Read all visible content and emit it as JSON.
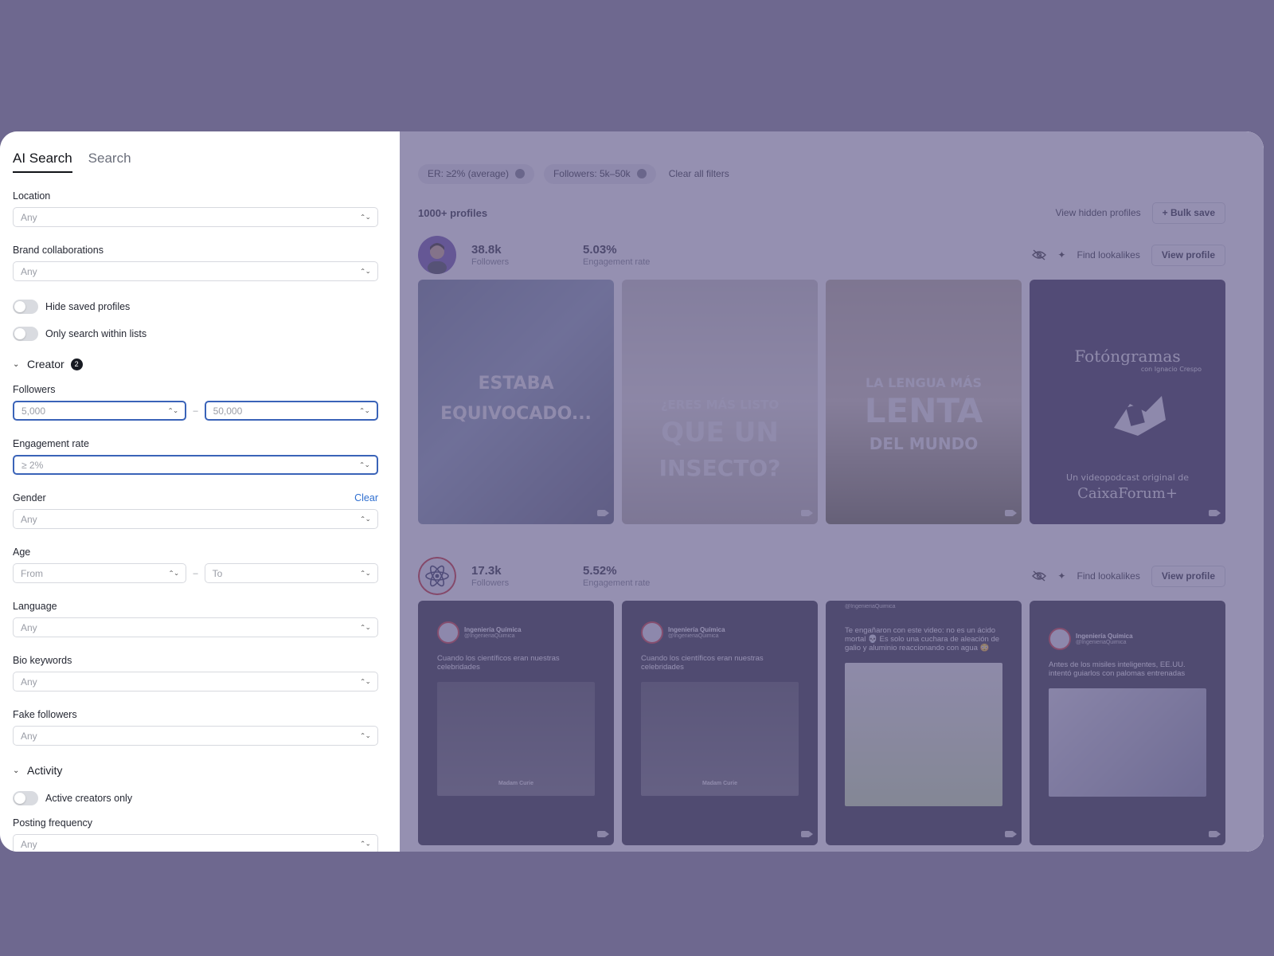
{
  "sidebar": {
    "tabs": [
      {
        "label": "AI Search"
      },
      {
        "label": "Search"
      }
    ],
    "location": {
      "label": "Location",
      "value": "Any"
    },
    "brand_collaborations": {
      "label": "Brand collaborations",
      "value": "Any"
    },
    "toggles": {
      "hide_saved": "Hide saved profiles",
      "only_lists": "Only search within lists"
    },
    "creator_section": {
      "title": "Creator",
      "badge": "2"
    },
    "followers": {
      "label": "Followers",
      "from_placeholder": "5,000",
      "dash": "–",
      "to_placeholder": "50,000"
    },
    "engagement": {
      "label": "Engagement rate",
      "placeholder": "≥ 2%"
    },
    "gender": {
      "label": "Gender",
      "clear": "Clear",
      "value": "Any"
    },
    "age": {
      "label": "Age",
      "from": "From",
      "dash": "–",
      "to": "To"
    },
    "language": {
      "label": "Language",
      "value": "Any"
    },
    "bio_keywords": {
      "label": "Bio keywords",
      "value": "Any"
    },
    "fake_followers": {
      "label": "Fake followers",
      "value": "Any"
    },
    "activity_section": {
      "title": "Activity"
    },
    "active_only": "Active creators only",
    "posting_frequency": {
      "label": "Posting frequency",
      "value": "Any"
    }
  },
  "main": {
    "chips": [
      {
        "label": "ER: ≥2% (average)"
      },
      {
        "label": "Followers: 5k–50k"
      }
    ],
    "clear_all": "Clear all filters",
    "count": "1000+ profiles",
    "view_hidden": "View hidden profiles",
    "bulk_save": "+ Bulk save",
    "find_lookalikes": "Find lookalikes",
    "view_profile": "View profile",
    "creators": [
      {
        "followers": "38.8k",
        "followers_label": "Followers",
        "er": "5.03%",
        "er_label": "Engagement rate",
        "tiles": [
          {
            "lines": [
              "ESTABA",
              "EQUIVOCADO..."
            ]
          },
          {
            "lines": [
              "¿ERES MÁS LISTO",
              "QUE UN",
              "INSECTO?"
            ]
          },
          {
            "lines": [
              "LA LENGUA MÁS",
              "LENTA",
              "DEL MUNDO"
            ]
          },
          {
            "lines": [
              "Fotóngramas",
              "con Ignacio Crespo",
              "Un videopodcast original de",
              "CaixaForum+"
            ]
          }
        ]
      },
      {
        "followers": "17.3k",
        "followers_label": "Followers",
        "er": "5.52%",
        "er_label": "Engagement rate",
        "posts": [
          {
            "name": "Ingeniería Química",
            "handle": "@IngenieriaQuimica",
            "text": "Cuando los científicos eran nuestras celebridades",
            "caption": "Madam Curie"
          },
          {
            "name": "Ingeniería Química",
            "handle": "@IngenieriaQuimica",
            "text": "Cuando los científicos eran nuestras celebridades",
            "caption": "Madam Curie"
          },
          {
            "name": "",
            "handle": "@IngenieriaQuimica",
            "text": "Te engañaron con este video: no es un ácido mortal 💀 Es solo una cuchara de aleación de galio y aluminio reaccionando con agua 😳",
            "caption": ""
          },
          {
            "name": "Ingeniería Química",
            "handle": "@IngenieriaQuimica",
            "text": "Antes de los misiles inteligentes, EE.UU. intentó guiarlos con palomas entrenadas",
            "caption": ""
          }
        ]
      }
    ]
  }
}
